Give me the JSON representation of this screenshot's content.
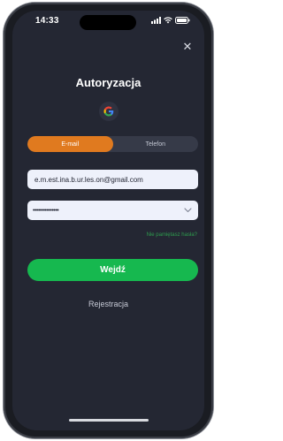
{
  "status_bar": {
    "time": "14:33"
  },
  "header": {
    "close_symbol": "✕",
    "title": "Autoryzacja"
  },
  "google_login": {
    "icon": "google-icon"
  },
  "tabs": [
    {
      "label": "E-mail",
      "active": true
    },
    {
      "label": "Telefon",
      "active": false
    }
  ],
  "form": {
    "email_value": "e.m.est.ina.b.ur.les.on@gmail.com",
    "password_mask": "•••••••••••••••",
    "forgot_label": "Nie pamiętasz hasła?",
    "submit_label": "Wejdź",
    "register_label": "Rejestracja"
  },
  "colors": {
    "accent_orange": "#e07a1f",
    "primary_green": "#16b84f",
    "link_green": "#2e9d4e",
    "background": "#242733"
  }
}
